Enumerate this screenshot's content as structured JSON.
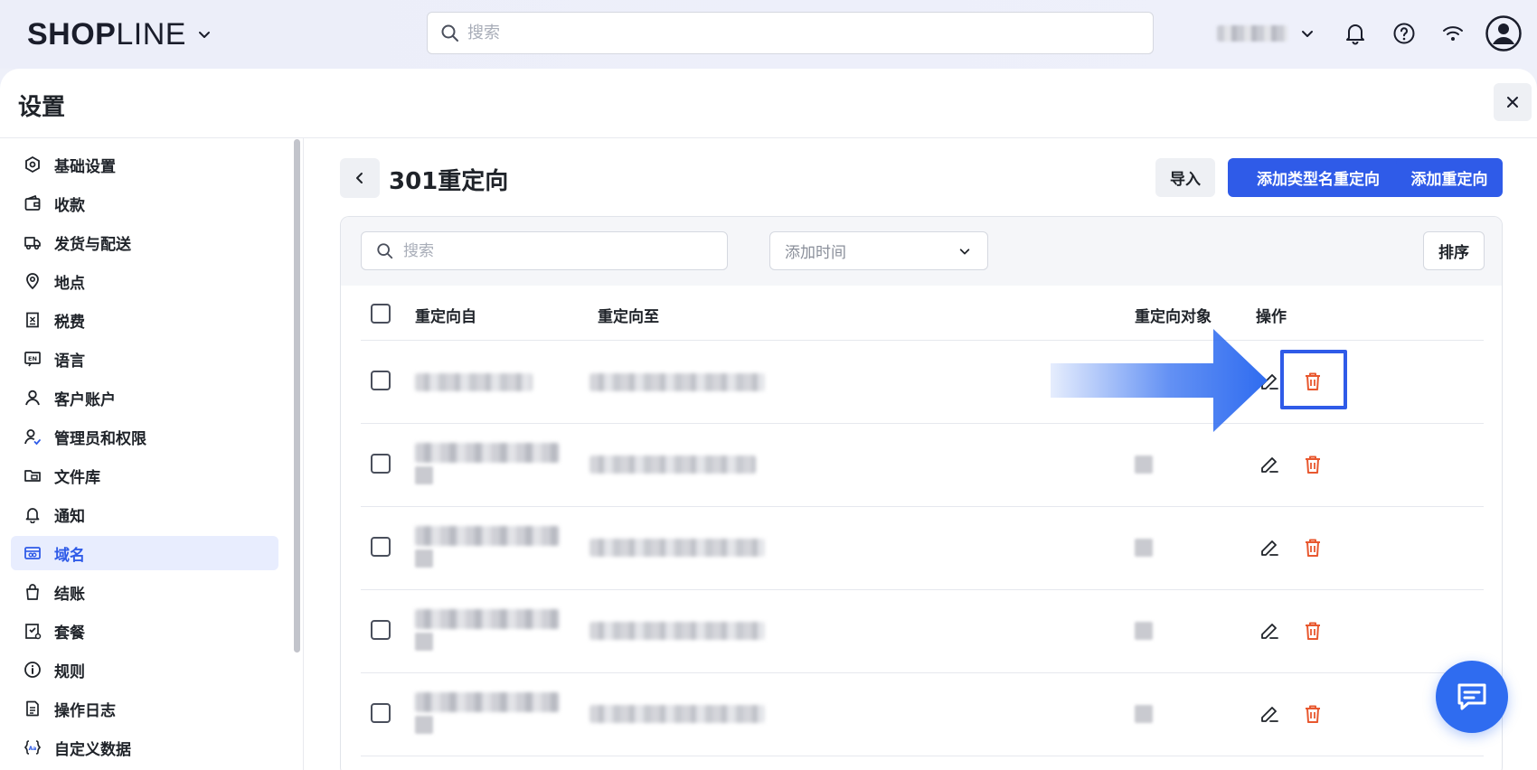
{
  "topbar": {
    "logo_bold": "SHOP",
    "logo_light": "LINE",
    "search_placeholder": "搜索"
  },
  "panel": {
    "title": "设置"
  },
  "sidebar": {
    "items": [
      {
        "label": "基础设置",
        "icon": "settings-hexagon-icon"
      },
      {
        "label": "收款",
        "icon": "wallet-icon"
      },
      {
        "label": "发货与配送",
        "icon": "truck-icon"
      },
      {
        "label": "地点",
        "icon": "location-pin-icon"
      },
      {
        "label": "税费",
        "icon": "tax-receipt-icon"
      },
      {
        "label": "语言",
        "icon": "language-en-icon"
      },
      {
        "label": "客户账户",
        "icon": "user-icon"
      },
      {
        "label": "管理员和权限",
        "icon": "admin-permission-icon"
      },
      {
        "label": "文件库",
        "icon": "folder-icon"
      },
      {
        "label": "通知",
        "icon": "bell-icon"
      },
      {
        "label": "域名",
        "icon": "domain-link-icon",
        "active": true
      },
      {
        "label": "结账",
        "icon": "shopping-bag-icon"
      },
      {
        "label": "套餐",
        "icon": "package-plan-icon"
      },
      {
        "label": "规则",
        "icon": "info-icon"
      },
      {
        "label": "操作日志",
        "icon": "log-document-icon"
      },
      {
        "label": "自定义数据",
        "icon": "custom-data-icon"
      }
    ]
  },
  "page": {
    "title": "301重定向",
    "buttons": {
      "import": "导入",
      "add_type_redirect": "添加类型名重定向",
      "add_redirect": "添加重定向"
    },
    "filter": {
      "search_placeholder": "搜索",
      "select_placeholder": "添加时间",
      "sort": "排序"
    },
    "table": {
      "headers": {
        "from": "重定向自",
        "to": "重定向至",
        "target": "重定向对象",
        "actions": "操作"
      },
      "rows": 5
    }
  },
  "colors": {
    "accent": "#2f5be8",
    "delete": "#e8582f",
    "active_bg": "#e8edfe"
  }
}
